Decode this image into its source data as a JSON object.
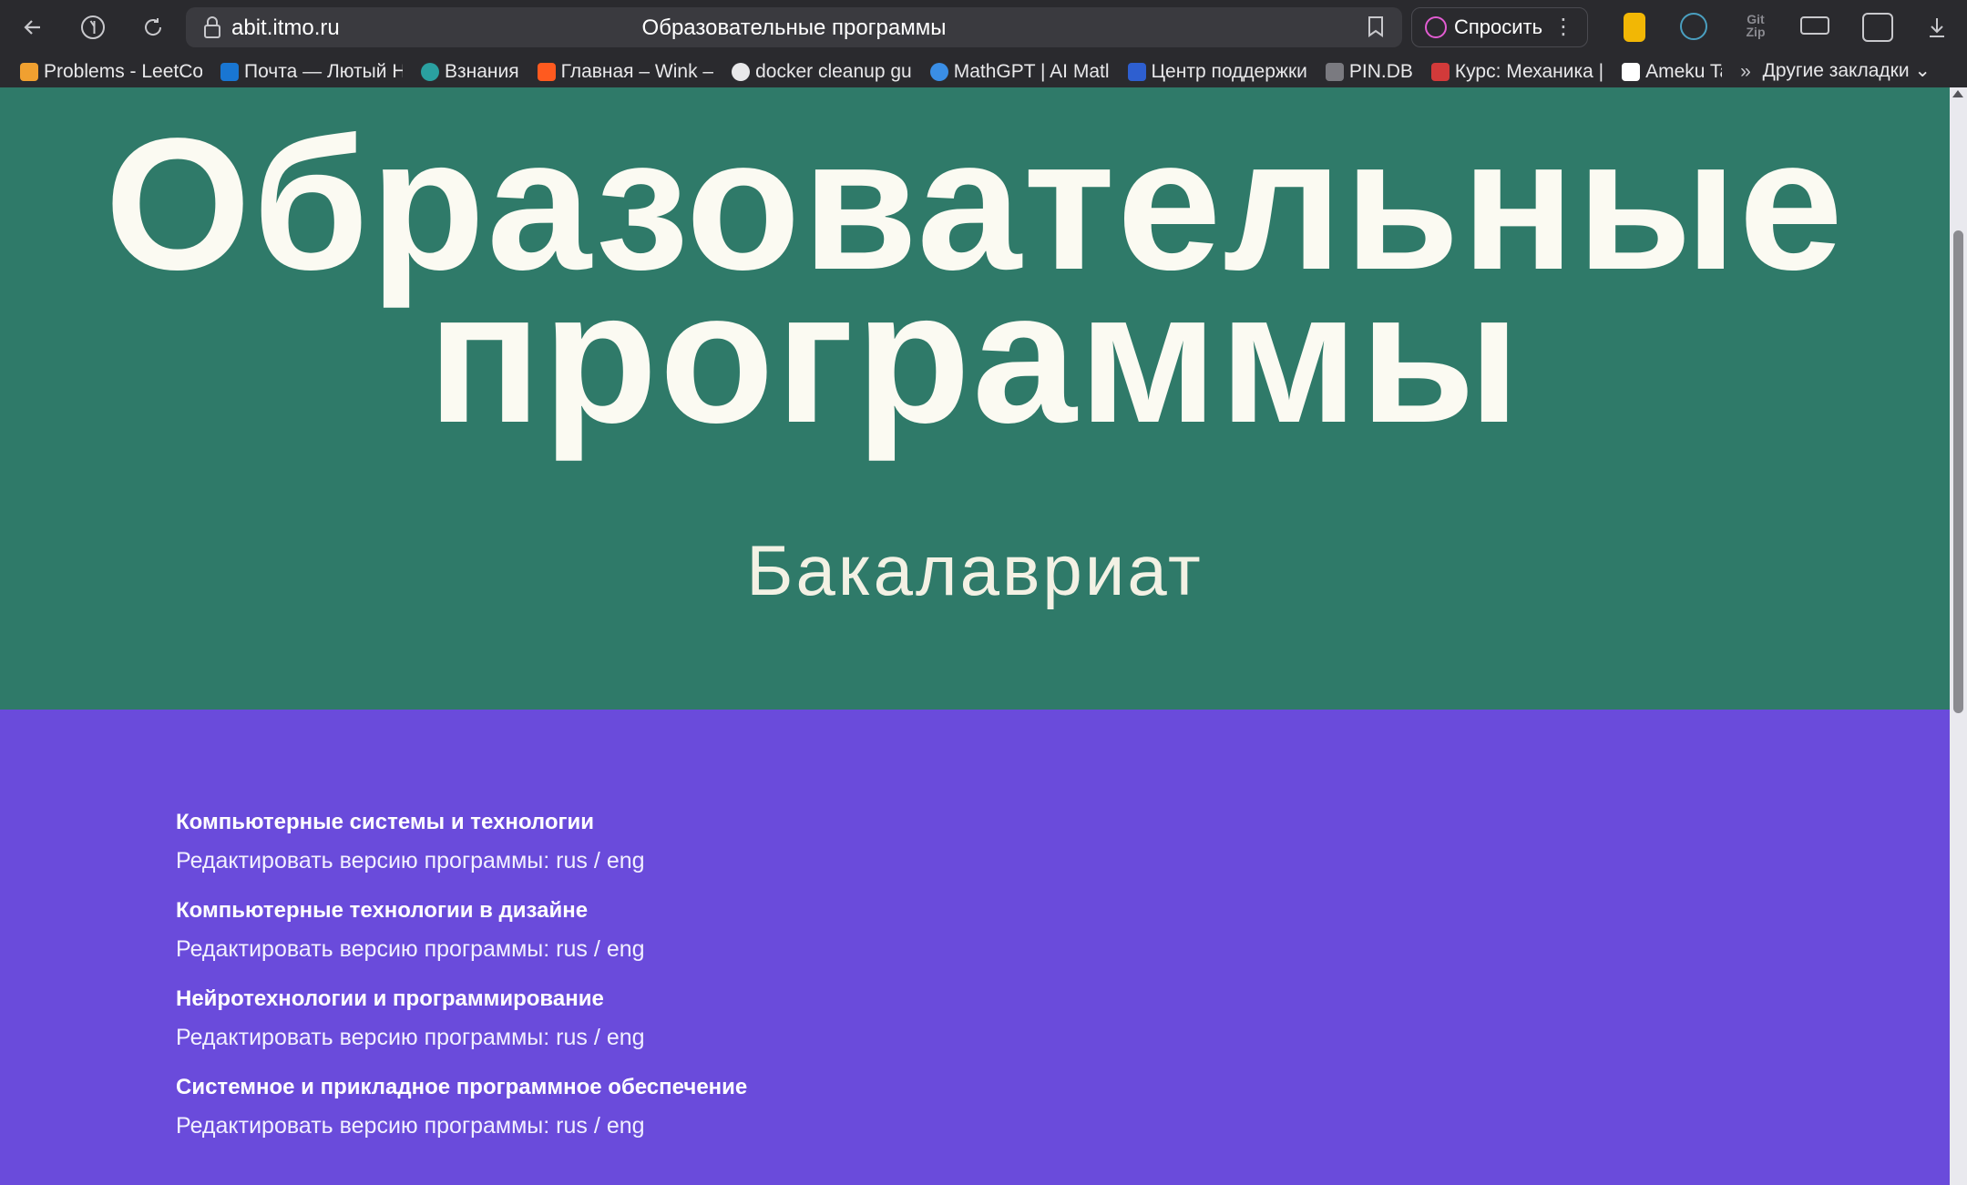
{
  "browser": {
    "url": "abit.itmo.ru",
    "tab_title": "Образовательные программы",
    "ask_label": "Спросить",
    "other_bookmarks": "Другие закладки",
    "bookmarks": [
      {
        "label": "Problems - LeetCo",
        "color": "#f0a030"
      },
      {
        "label": "Почта — Лютый Н",
        "color": "#1976d2"
      },
      {
        "label": "Взнания",
        "color": "#2aa0a0"
      },
      {
        "label": "Главная – Wink –",
        "color": "#ff5a1f"
      },
      {
        "label": "docker cleanup gu",
        "color": "#e8e8ea"
      },
      {
        "label": "MathGPT | AI Matl",
        "color": "#3a8ee6"
      },
      {
        "label": "Центр поддержки",
        "color": "#2e5fd0"
      },
      {
        "label": "PIN.DB",
        "color": "#7a7a80"
      },
      {
        "label": "Курс: Механика |",
        "color": "#d23a3a"
      },
      {
        "label": "Ameku Ta",
        "color": "#ffffff"
      }
    ]
  },
  "hero": {
    "title_line1": "Образовательные",
    "title_line2": "программы",
    "subtitle": "Бакалавриат"
  },
  "programs": [
    {
      "name": "Компьютерные системы и технологии",
      "edit_prefix": "Редактировать версию программы:",
      "rus": "rus",
      "sep": "/",
      "eng": "eng"
    },
    {
      "name": "Компьютерные технологии в дизайне",
      "edit_prefix": "Редактировать версию программы:",
      "rus": "rus",
      "sep": "/",
      "eng": "eng"
    },
    {
      "name": "Нейротехнологии и программирование",
      "edit_prefix": "Редактировать версию программы:",
      "rus": "rus",
      "sep": "/",
      "eng": "eng"
    },
    {
      "name": "Системное и прикладное программное обеспечение",
      "edit_prefix": "Редактировать версию программы:",
      "rus": "rus",
      "sep": "/",
      "eng": "eng"
    }
  ],
  "colors": {
    "hero_bg": "#2f7a69",
    "programs_bg": "#6a4bdb"
  }
}
